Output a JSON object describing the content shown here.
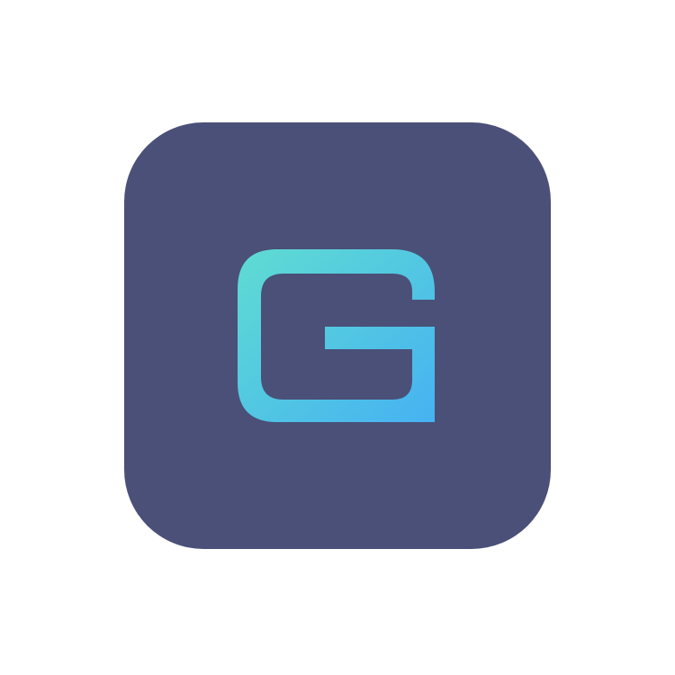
{
  "app_icon": {
    "icon": "g-logo-icon",
    "letter": "G",
    "colors": {
      "tile_background": "#4a5078",
      "glyph_gradient_start": "#5fdcd2",
      "glyph_gradient_end": "#46b2f2",
      "page_background": "#ffffff"
    }
  }
}
